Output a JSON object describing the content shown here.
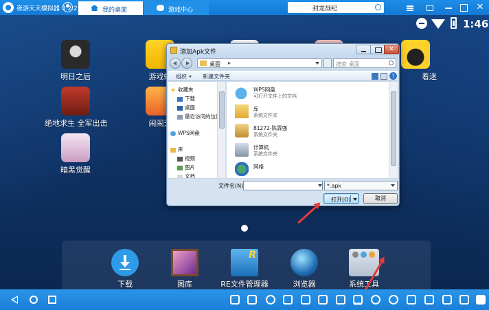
{
  "titlebar": {
    "app_title": "夜游天天模拟器 3.2.2",
    "tabs": [
      {
        "label": "我的桌面"
      },
      {
        "label": "游戏中心"
      }
    ],
    "search_text": "封龙战纪"
  },
  "status": {
    "time": "1:46"
  },
  "apps": {
    "mingri": "明日之后",
    "youxi": "游戏蛙",
    "zhaomi": "着迷",
    "juedi": "绝地求生 全军出击",
    "naonao": "闹闹天",
    "anhei": "暗黑觉醒"
  },
  "dock": {
    "download": "下载",
    "gallery": "图库",
    "re_manager": "RE文件管理器",
    "browser": "浏览器",
    "system_tools": "系统工具"
  },
  "dialog": {
    "title": "添加Apk文件",
    "address": "桌面",
    "address_sep": "▸",
    "search_placeholder": "搜索 桌面",
    "toolbar": {
      "organize": "组织",
      "new_folder": "新建文件夹",
      "help": "?"
    },
    "nav_items": [
      {
        "label": "收藏夹",
        "icon": "star-icon"
      },
      {
        "label": "下载",
        "icon": "folder-icon"
      },
      {
        "label": "桌面",
        "icon": "desktop-icon"
      },
      {
        "label": "最近访问的位置",
        "icon": "recent-icon"
      },
      {
        "label": "WPS网盘",
        "icon": "cloud-icon"
      },
      {
        "label": "库",
        "icon": "library-icon"
      },
      {
        "label": "视频",
        "icon": "video-icon"
      },
      {
        "label": "图片",
        "icon": "image-icon"
      },
      {
        "label": "文档",
        "icon": "document-icon"
      }
    ],
    "files": [
      {
        "name": "WPS网盘",
        "sub": "可打开文件上的文档"
      },
      {
        "name": "库",
        "sub": "系统文件夹"
      },
      {
        "name": "81272-陈霖强",
        "sub": "系统文件夹"
      },
      {
        "name": "计算机",
        "sub": "系统文件夹"
      },
      {
        "name": "网络",
        "sub": ""
      }
    ],
    "filename_label": "文件名(N):",
    "filename_value": "",
    "filetype": "*.apk",
    "open_button": "打开(O)",
    "cancel_button": "取消"
  },
  "sysbar": {
    "apk_caption": "APK"
  },
  "colors": {
    "titlebar_blue": "#1a86e0",
    "sysbar_blue": "#1f89dd",
    "annotation_red": "#e53b3b",
    "desktop_bg": "#11386b"
  }
}
